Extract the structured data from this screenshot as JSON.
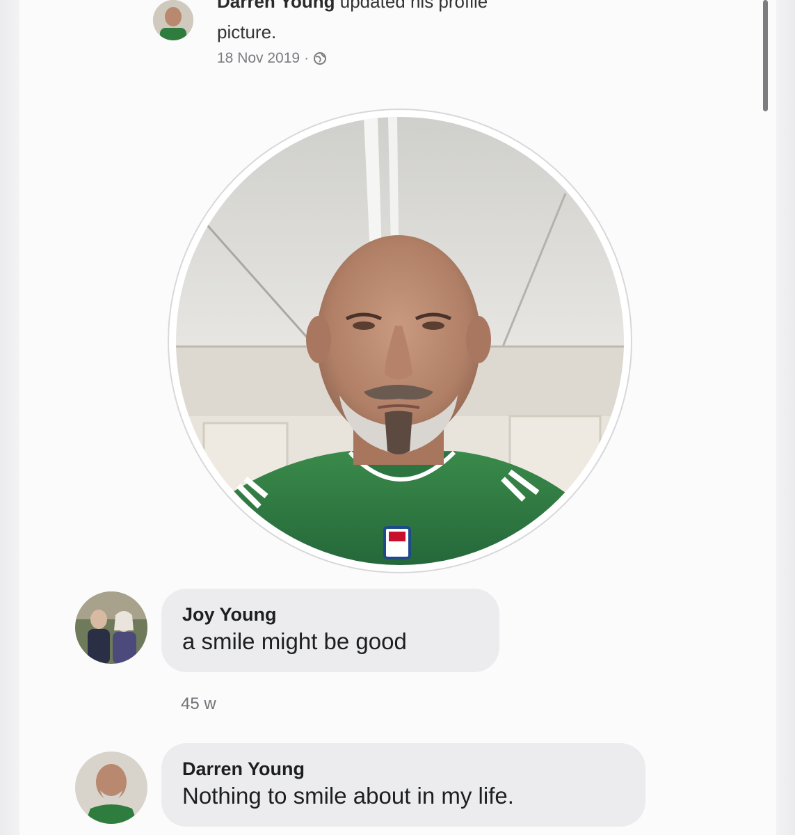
{
  "post": {
    "author": "Darren Young",
    "action_line1": "updated his profile",
    "action_line2": "picture.",
    "date": "18 Nov 2019",
    "separator": "·",
    "privacy_icon": "globe-icon"
  },
  "comments": [
    {
      "author": "Joy Young",
      "text": "a smile might be good",
      "time": "45 w"
    },
    {
      "author": "Darren Young",
      "text": "Nothing to smile about in my life."
    }
  ],
  "colors": {
    "bubble": "#ececef",
    "jersey_green": "#2f7d3e",
    "meta_text": "#7a7c80"
  }
}
